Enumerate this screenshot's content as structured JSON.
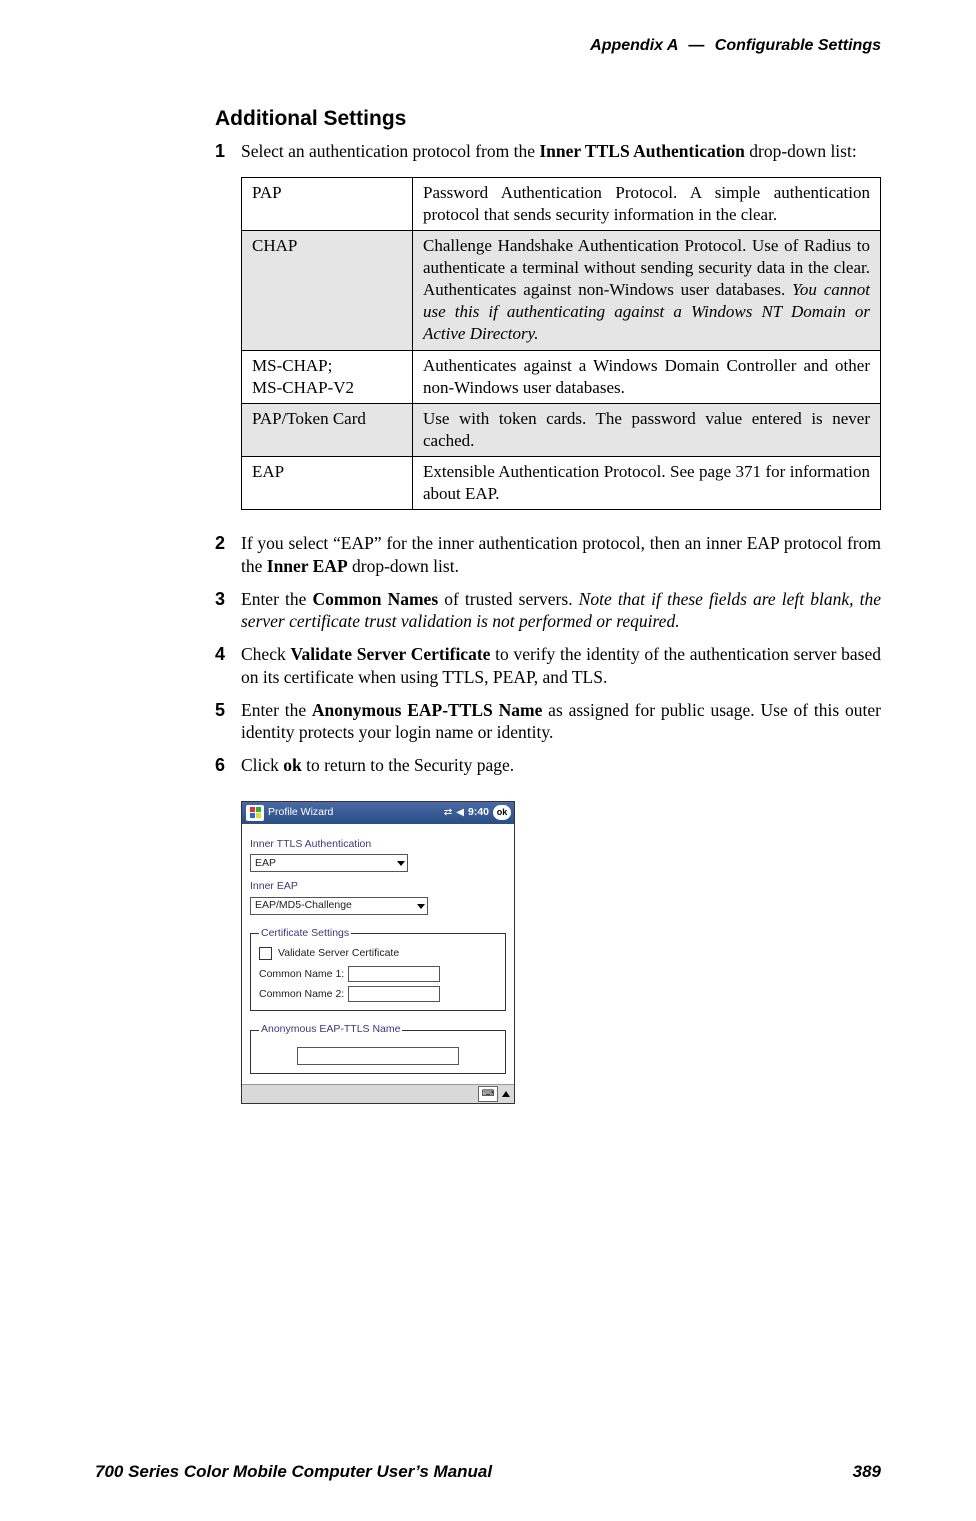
{
  "header": {
    "appendix": "Appendix A",
    "dash": "—",
    "title": "Configurable Settings"
  },
  "section_title": "Additional Settings",
  "steps": {
    "s1": {
      "num": "1",
      "pre": "Select an authentication protocol from the ",
      "bold": "Inner TTLS Authentication",
      "post": " drop-down list:"
    },
    "s2": {
      "num": "2",
      "pre": "If you select “EAP” for the inner authentication protocol, then an inner EAP protocol from the ",
      "bold": "Inner EAP",
      "post": " drop-down list."
    },
    "s3": {
      "num": "3",
      "pre": "Enter the ",
      "bold": "Common Names",
      "mid": " of trusted servers. ",
      "ital": "Note that if these fields are left blank, the server certificate trust validation is not performed or required."
    },
    "s4": {
      "num": "4",
      "pre": "Check ",
      "bold": "Validate Server Certificate",
      "post": " to verify the identity of the authentication server based on its certificate when using TTLS, PEAP, and TLS."
    },
    "s5": {
      "num": "5",
      "pre": "Enter the ",
      "bold": "Anonymous EAP-TTLS Name",
      "post": " as assigned for public usage. Use of this outer identity protects your login name or identity."
    },
    "s6": {
      "num": "6",
      "pre": "Click ",
      "bold": "ok",
      "post": " to return to the Security page."
    }
  },
  "table": {
    "rows": [
      {
        "name": "PAP",
        "desc_plain": "Password Authentication Protocol. A simple authentication protocol that sends security information in the clear."
      },
      {
        "name": "CHAP",
        "desc_plain": "Challenge Handshake Authentication Protocol. Use of Radius to authenticate a terminal without sending security data in the clear. Authenticates against non-Windows user databases. ",
        "desc_ital": "You cannot use this if authenticating against a Windows NT Domain or Active Directory."
      },
      {
        "name": "MS-CHAP;\nMS-CHAP-V2",
        "desc_plain": "Authenticates against a Windows Domain Controller and other non-Windows user databases."
      },
      {
        "name": "PAP/Token Card",
        "desc_plain": "Use with token cards. The password value entered is never cached."
      },
      {
        "name": "EAP",
        "desc_plain": "Extensible Authentication Protocol. See page 371 for information about EAP."
      }
    ]
  },
  "device": {
    "title": "Profile Wizard",
    "time": "9:40",
    "ok": "ok",
    "lbl_inner_ttls": "Inner TTLS Authentication",
    "combo_ttls": "EAP",
    "lbl_inner_eap": "Inner EAP",
    "combo_eap": "EAP/MD5-Challenge",
    "cert_legend": "Certificate Settings",
    "chk_label": "Validate Server Certificate",
    "cn1": "Common Name 1:",
    "cn2": "Common Name 2:",
    "anon_legend": "Anonymous EAP-TTLS Name"
  },
  "footer": {
    "left": "700 Series Color Mobile Computer User’s Manual",
    "right": "389"
  }
}
